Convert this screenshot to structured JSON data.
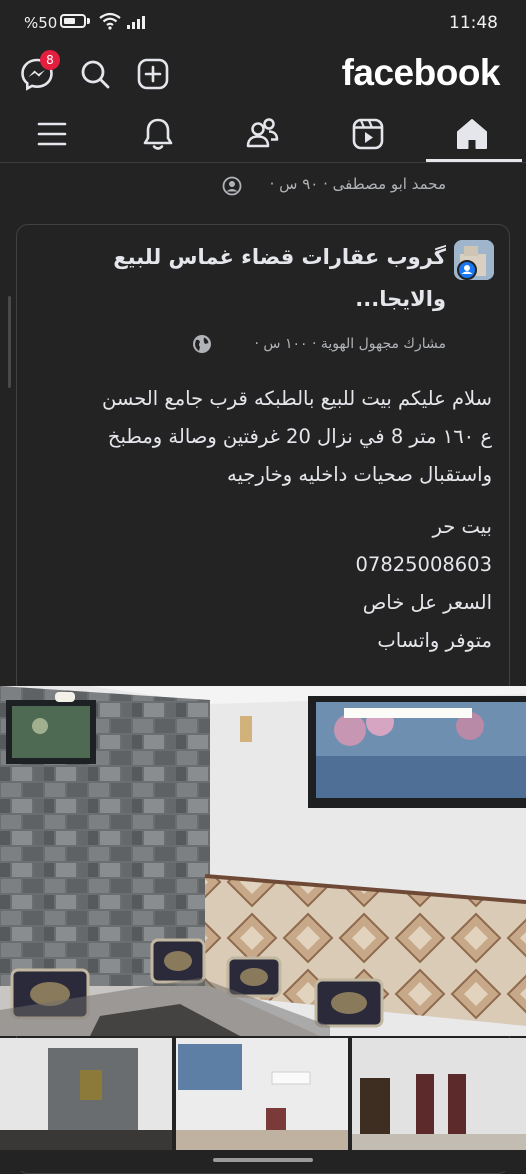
{
  "status_bar": {
    "battery_text": "%50",
    "time": "11:48"
  },
  "header": {
    "logo": "facebook",
    "messenger_badge": "8",
    "icons": [
      "messenger-icon",
      "search-icon",
      "add-icon"
    ]
  },
  "tabs": [
    "menu-icon",
    "bell-icon",
    "friends-icon",
    "video-icon",
    "home-icon"
  ],
  "shared_by": "محمد ابو مصطفى · ٩٠ س ·",
  "post": {
    "group_title": "گروب عقارات قضاء غماس للبيع والايجا...",
    "meta": "مشارك مجهول الهوية · ١٠٠ س ·",
    "lines": [
      "سلام عليكم بيت للبيع بالطبكه قرب جامع الحسن",
      "ع ١٦٠ متر 8 في نزال 20 غرفتين وصالة ومطبخ",
      "واستقبال صحيات داخليه وخارجيه",
      "بيت حر",
      "07825008603",
      "السعر عل خاص",
      "متوفر واتساب"
    ]
  },
  "colors": {
    "background": "#232323",
    "text": "#e4e6eb",
    "secondary_text": "#b0b3b8",
    "badge": "#e41e3f"
  }
}
